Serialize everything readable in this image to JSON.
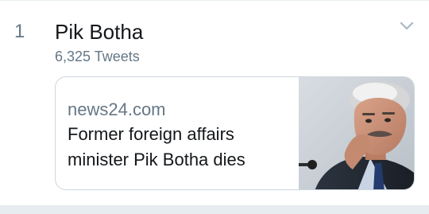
{
  "trend": {
    "rank": "1",
    "title": "Pik Botha",
    "tweet_count": "6,325 Tweets"
  },
  "card": {
    "domain": "news24.com",
    "headline": "Former foreign affairs minister Pik Botha dies"
  },
  "icons": {
    "chevron": "chevron-down-icon"
  },
  "colors": {
    "primary_text": "#14171a",
    "secondary_text": "#657786",
    "border": "#ccd6dd"
  }
}
